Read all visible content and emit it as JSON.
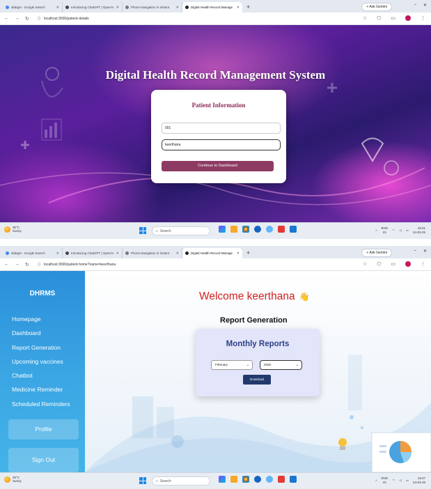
{
  "browser": {
    "tabs": [
      {
        "title": "diabget - Google Search"
      },
      {
        "title": "Introducing ChatGPT | OpenAI"
      },
      {
        "title": "Phone Navigation in Instant"
      },
      {
        "title": "Digital Health Record Manage",
        "active": true
      }
    ],
    "tabs2": [
      {
        "title": "diabget - Google Search"
      },
      {
        "title": "Introducing ChatGPT | OpenAI"
      },
      {
        "title": "Phone Navigation in Instant"
      },
      {
        "title": "Digital Health Record Manage",
        "active": true
      }
    ],
    "new_tab": "+",
    "ask_gemini": "+ Ask Gemini",
    "window_controls": [
      "–",
      "□",
      "✕"
    ]
  },
  "shot1": {
    "url": "localhost:3000/patient-details",
    "app_title": "Digital Health Record Management System",
    "card_title": "Patient Information",
    "patient_id_value": "001",
    "patient_name_value": "keerthana",
    "continue_label": "Continue to Dashboard",
    "taskbar": {
      "weather_temp": "30°C",
      "weather_desc": "Sunny",
      "search": "Search",
      "lang": "ENG",
      "region": "IN",
      "time": "19:21",
      "date": "24-03-25"
    }
  },
  "shot2": {
    "url": "localhost:3000/patient-home?name=keerthana",
    "brand": "DHRMS",
    "menu": [
      "Homepage",
      "Dashboard",
      "Report Generation",
      "Upcoming vaccines",
      "Chatbot",
      "Medicine Reminder",
      "Scheduled Reminders"
    ],
    "profile_label": "Profile",
    "signout_label": "Sign Out",
    "welcome": "Welcome keerthana",
    "wave": "👋",
    "section_title": "Report Generation",
    "card_title": "Monthly Reports",
    "month_value": "February",
    "year_value": "2026",
    "download_label": "Download",
    "taskbar": {
      "weather_temp": "30°C",
      "weather_desc": "Sunny",
      "search": "Search",
      "lang": "ENG",
      "region": "IN",
      "time": "19:27",
      "date": "24-03-25"
    }
  },
  "colors": {
    "accent_button": "#8e3b63",
    "card_title": "#8e2a55",
    "welcome_text": "#d32020",
    "monthly_title": "#2e4187",
    "download_button": "#223a6b",
    "sidebar": "#2a8fd9"
  },
  "icons": [
    "back-icon",
    "forward-icon",
    "reload-icon",
    "site-info-icon",
    "star-icon",
    "extensions-icon",
    "sidebar-icon",
    "profile-icon",
    "windows-start-icon",
    "search-icon",
    "wifi-icon",
    "volume-icon",
    "battery-icon",
    "wave-emoji-icon"
  ]
}
